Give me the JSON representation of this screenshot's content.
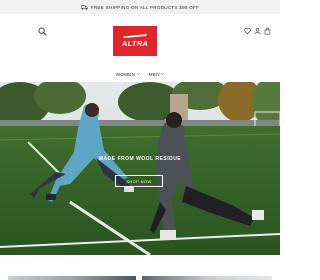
{
  "promo": {
    "text": "FREE SHIPPING ON ALL PRODUCTS $99 OFF",
    "icon": "truck-icon"
  },
  "header": {
    "logo_text": "ALTRA",
    "brand_color": "#e0262b",
    "icons": [
      "search-icon",
      "heart-icon",
      "user-icon",
      "bag-icon"
    ]
  },
  "nav": {
    "items": [
      {
        "label": "WOMEN"
      },
      {
        "label": "MEN"
      }
    ]
  },
  "hero": {
    "headline": "MADE FROM WOOL RESIDUE",
    "cta": "SHOP NOW"
  }
}
